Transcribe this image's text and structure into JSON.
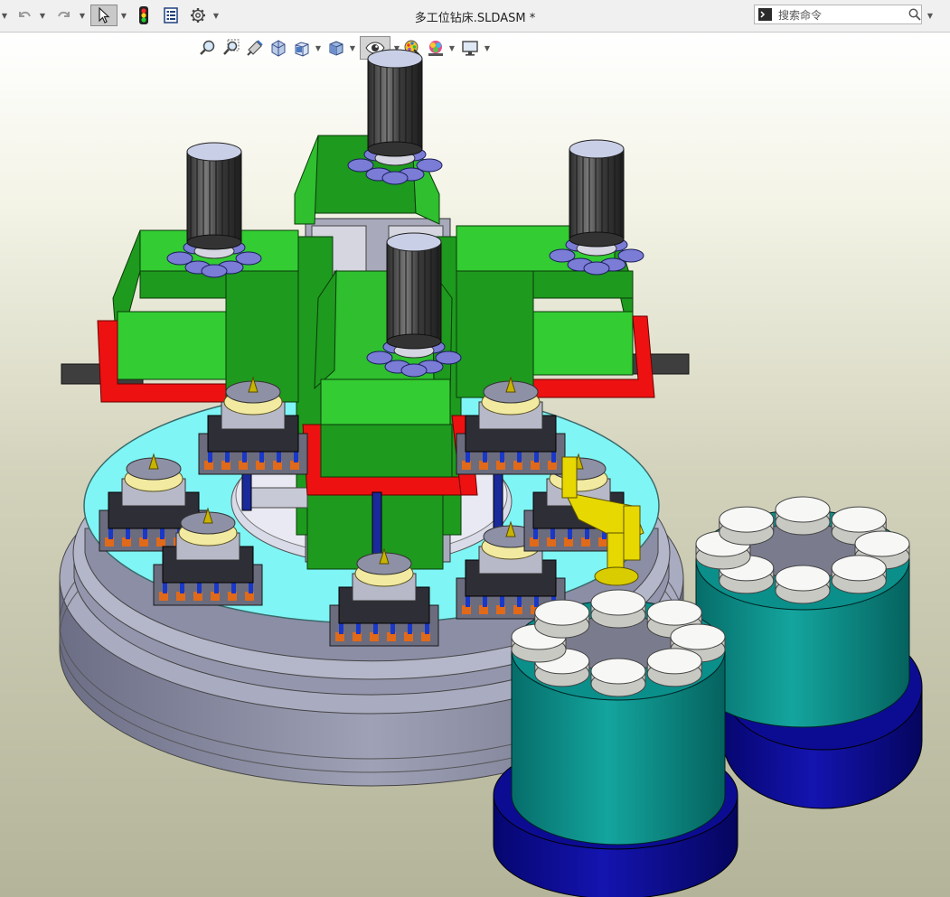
{
  "window": {
    "title": "多工位钻床.SLDASM *"
  },
  "toolbar": {
    "items": [
      "undo-icon",
      "redo-icon",
      "select-pointer-icon",
      "traffic-light-icon",
      "file-properties-icon",
      "gear-icon"
    ]
  },
  "search": {
    "placeholder": "搜索命令"
  },
  "headsup_toolbar": {
    "items": [
      "zoom-to-fit-icon",
      "zoom-to-area-icon",
      "previous-view-icon",
      "section-view-icon",
      "view-orientation-icon",
      "display-style-icon",
      "hide-show-items-icon",
      "edit-appearance-icon",
      "apply-scene-icon",
      "view-settings-icon"
    ],
    "active": "hide-show-items-icon"
  },
  "colors": {
    "frame_green": "#1e9a1e",
    "frame_light_green": "#33cc33",
    "red_trim": "#ee1111",
    "table_cyan": "#7ff5f5",
    "base_grey": "#8e90a6",
    "teal_magazine": "#0a8f8a",
    "navy_base": "#0c0c92",
    "robot_yellow": "#e6d800",
    "motor_dark": "#4a4a4a",
    "part_white": "#f7f7f5"
  }
}
